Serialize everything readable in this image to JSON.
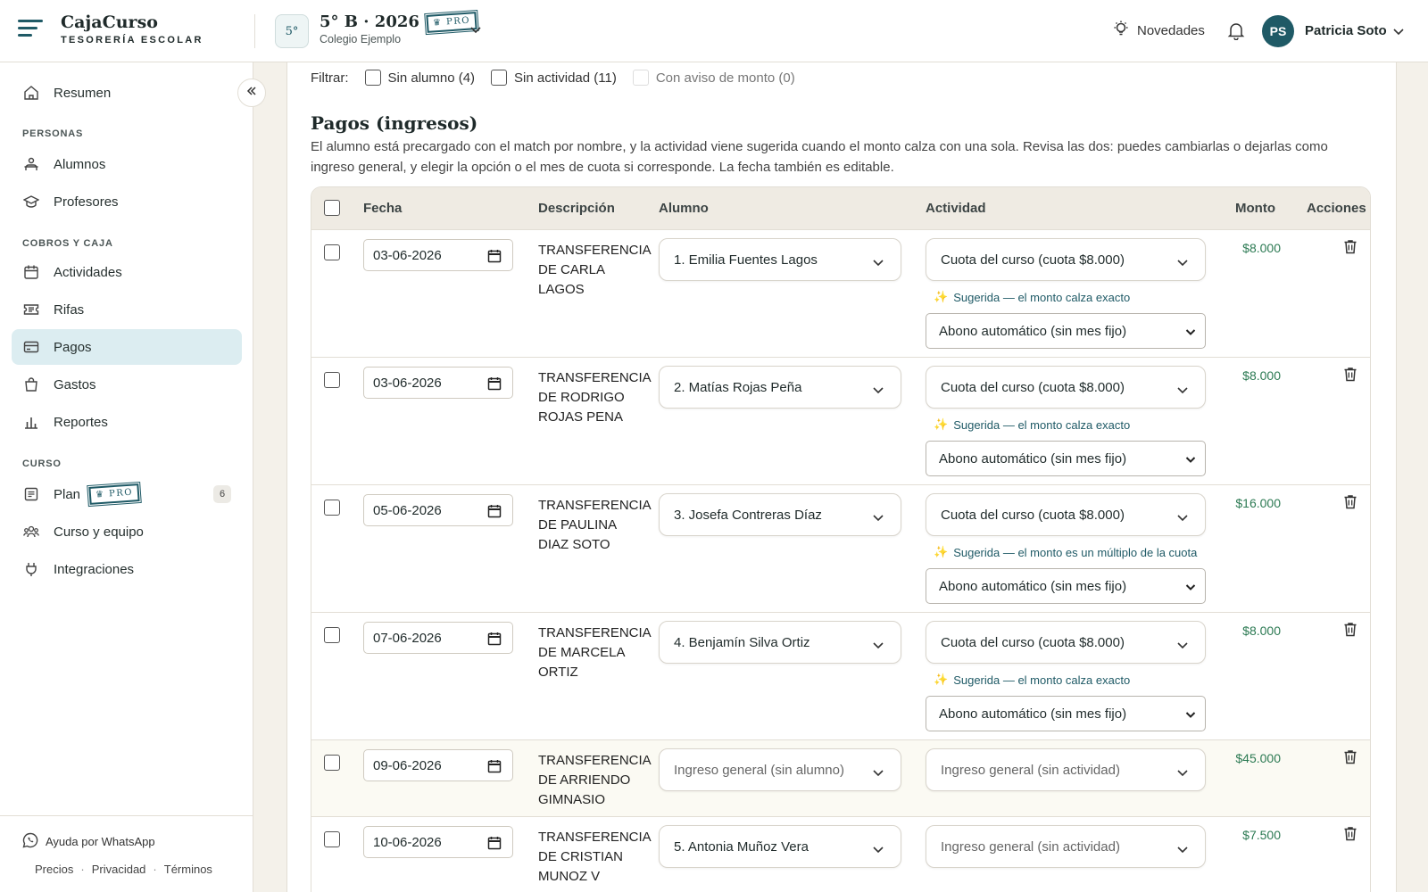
{
  "brand": {
    "name": "CajaCurso",
    "subtitle": "TESORERÍA ESCOLAR"
  },
  "course": {
    "badge": "5°",
    "title": "5° B · 2026",
    "pro": "♛ PRO",
    "school": "Colegio Ejemplo"
  },
  "header": {
    "novedades": "Novedades",
    "avatar_initials": "PS",
    "user_name": "Patricia Soto"
  },
  "sidebar": {
    "resumen": "Resumen",
    "section_personas": "PERSONAS",
    "alumnos": "Alumnos",
    "profesores": "Profesores",
    "section_cobros": "COBROS Y CAJA",
    "actividades": "Actividades",
    "rifas": "Rifas",
    "pagos": "Pagos",
    "gastos": "Gastos",
    "reportes": "Reportes",
    "section_curso": "CURSO",
    "plan": "Plan",
    "plan_pro": "♛ PRO",
    "plan_count": "6",
    "curso_equipo": "Curso y equipo",
    "integraciones": "Integraciones",
    "whatsapp": "Ayuda por WhatsApp",
    "precios": "Precios",
    "privacidad": "Privacidad",
    "terminos": "Términos",
    "sep": "·"
  },
  "filters": {
    "label": "Filtrar:",
    "sin_alumno": "Sin alumno (4)",
    "sin_actividad": "Sin actividad (11)",
    "con_aviso": "Con aviso de monto (0)"
  },
  "section": {
    "title": "Pagos (ingresos)",
    "description": "El alumno está precargado con el match por nombre, y la actividad viene sugerida cuando el monto calza con una sola. Revisa las dos: puedes cambiarlas o dejarlas como ingreso general, y elegir la opción o el mes de cuota si corresponde. La fecha también es editable."
  },
  "table": {
    "columns": {
      "fecha": "Fecha",
      "descripcion": "Descripción",
      "alumno": "Alumno",
      "actividad": "Actividad",
      "monto": "Monto",
      "acciones": "Acciones"
    },
    "rows": [
      {
        "fecha": "03-06-2026",
        "descripcion": "TRANSFERENCIA DE CARLA LAGOS",
        "alumno": "1. Emilia Fuentes Lagos",
        "actividad": "Cuota del curso (cuota $8.000)",
        "sugerencia": "Sugerida — el monto calza exacto",
        "mes": "Abono automático (sin mes fijo)",
        "monto": "$8.000"
      },
      {
        "fecha": "03-06-2026",
        "descripcion": "TRANSFERENCIA DE RODRIGO ROJAS PENA",
        "alumno": "2. Matías Rojas Peña",
        "actividad": "Cuota del curso (cuota $8.000)",
        "sugerencia": "Sugerida — el monto calza exacto",
        "mes": "Abono automático (sin mes fijo)",
        "monto": "$8.000"
      },
      {
        "fecha": "05-06-2026",
        "descripcion": "TRANSFERENCIA DE PAULINA DIAZ SOTO",
        "alumno": "3. Josefa Contreras Díaz",
        "actividad": "Cuota del curso (cuota $8.000)",
        "sugerencia": "Sugerida — el monto es un múltiplo de la cuota",
        "mes": "Abono automático (sin mes fijo)",
        "monto": "$16.000"
      },
      {
        "fecha": "07-06-2026",
        "descripcion": "TRANSFERENCIA DE MARCELA ORTIZ",
        "alumno": "4. Benjamín Silva Ortiz",
        "actividad": "Cuota del curso (cuota $8.000)",
        "sugerencia": "Sugerida — el monto calza exacto",
        "mes": "Abono automático (sin mes fijo)",
        "monto": "$8.000"
      },
      {
        "fecha": "09-06-2026",
        "descripcion": "TRANSFERENCIA DE ARRIENDO GIMNASIO",
        "alumno": "Ingreso general (sin alumno)",
        "actividad": "Ingreso general (sin actividad)",
        "monto": "$45.000"
      },
      {
        "fecha": "10-06-2026",
        "descripcion": "TRANSFERENCIA DE CRISTIAN MUNOZ V",
        "alumno": "5. Antonia Muñoz Vera",
        "actividad": "Ingreso general (sin actividad)",
        "monto": "$7.500"
      }
    ]
  },
  "colors": {
    "accent": "#1f5a66",
    "active_nav": "#dcedf1",
    "amount": "#2c7a53",
    "background": "#f4f1ea"
  }
}
